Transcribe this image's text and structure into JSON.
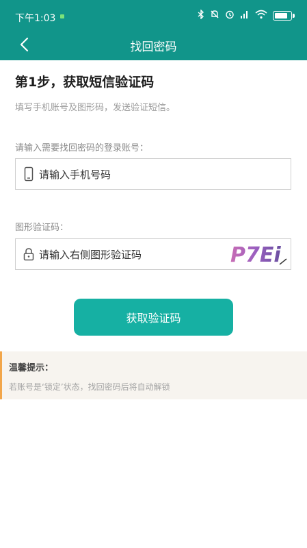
{
  "status_bar": {
    "time": "下午1:03"
  },
  "header": {
    "title": "找回密码"
  },
  "step": {
    "title": "第1步，获取短信验证码",
    "description": "填写手机账号及图形码，发送验证短信。"
  },
  "account": {
    "label": "请输入需要找回密码的登录账号：",
    "placeholder": "请输入手机号码"
  },
  "captcha": {
    "label": "图形验证码：",
    "placeholder": "请输入右侧图形验证码",
    "image_text": "P7Ei"
  },
  "submit_label": "获取验证码",
  "tips": {
    "title": "温馨提示：",
    "text": "若账号是‘锁定’状态，找回密码后将自动解锁"
  },
  "colors": {
    "header": "#11958a",
    "button": "#16b0a3",
    "tip_accent": "#f2a64a"
  }
}
